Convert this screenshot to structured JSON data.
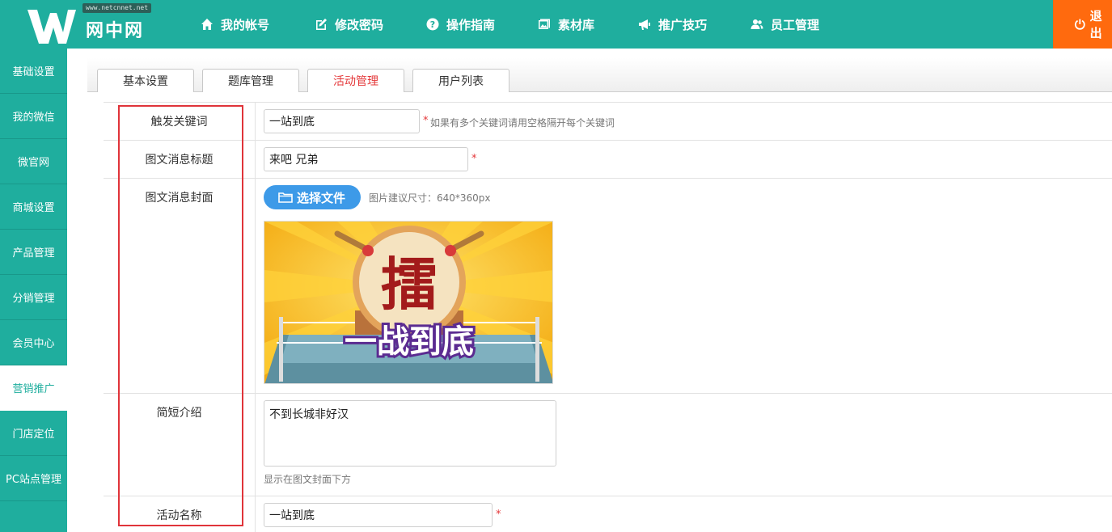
{
  "logo": {
    "url_text": "www.netcnnet.net",
    "name": "网中网"
  },
  "nav": [
    {
      "label": "我的帐号",
      "icon": "home-icon"
    },
    {
      "label": "修改密码",
      "icon": "edit-icon"
    },
    {
      "label": "操作指南",
      "icon": "help-icon"
    },
    {
      "label": "素材库",
      "icon": "image-library-icon"
    },
    {
      "label": "推广技巧",
      "icon": "megaphone-icon"
    },
    {
      "label": "员工管理",
      "icon": "users-icon"
    }
  ],
  "logout": {
    "label": "退出",
    "icon": "power-icon"
  },
  "sidebar": {
    "active_index": 7,
    "items": [
      {
        "label": "基础设置"
      },
      {
        "label": "我的微信"
      },
      {
        "label": "微官网"
      },
      {
        "label": "商城设置"
      },
      {
        "label": "产品管理"
      },
      {
        "label": "分销管理"
      },
      {
        "label": "会员中心"
      },
      {
        "label": "营销推广"
      },
      {
        "label": "门店定位"
      },
      {
        "label": "PC站点管理"
      }
    ]
  },
  "tabs": {
    "active_index": 2,
    "items": [
      {
        "label": "基本设置"
      },
      {
        "label": "题库管理"
      },
      {
        "label": "活动管理"
      },
      {
        "label": "用户列表"
      }
    ]
  },
  "form": {
    "keyword": {
      "label": "触发关键词",
      "value": "一站到底",
      "required": "*",
      "hint": "如果有多个关键词请用空格隔开每个关键词"
    },
    "title": {
      "label": "图文消息标题",
      "value": "来吧 兄弟",
      "required": "*"
    },
    "cover": {
      "label": "图文消息封面",
      "button": "选择文件",
      "hint": "图片建议尺寸：640*360px",
      "image_char": "擂",
      "image_text": "一战到底"
    },
    "intro": {
      "label": "简短介绍",
      "value": "不到长城非好汉",
      "hint": "显示在图文封面下方"
    },
    "name": {
      "label": "活动名称",
      "value": "一站到底",
      "required": "*"
    }
  },
  "colors": {
    "primary": "#1fae9e",
    "logout": "#ff6a0e",
    "active_tab": "#e4383a",
    "highlight": "#e0343a",
    "button": "#3d9ae8"
  }
}
